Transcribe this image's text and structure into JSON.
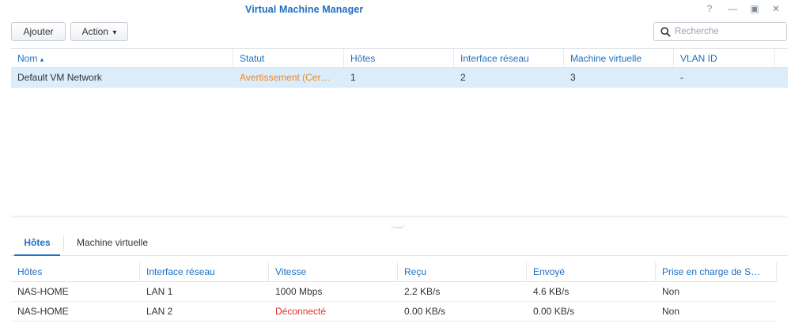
{
  "window": {
    "title": "Virtual Machine Manager",
    "controls": {
      "help": "?",
      "minimize": "—",
      "maximize": "▣",
      "close": "✕"
    }
  },
  "toolbar": {
    "add_label": "Ajouter",
    "action_label": "Action",
    "action_caret": "▾",
    "search_placeholder": "Recherche"
  },
  "top_table": {
    "columns": [
      "Nom",
      "Statut",
      "Hôtes",
      "Interface réseau",
      "Machine virtuelle",
      "VLAN ID"
    ],
    "sort_indicator": "▴",
    "rows": [
      {
        "name": "Default VM Network",
        "status": "Avertissement (Cer…",
        "hosts": "1",
        "interfaces": "2",
        "vms": "3",
        "vlan": "-"
      }
    ]
  },
  "tabs": [
    "Hôtes",
    "Machine virtuelle"
  ],
  "bottom_table": {
    "columns": [
      "Hôtes",
      "Interface réseau",
      "Vitesse",
      "Reçu",
      "Envoyé",
      "Prise en charge de S…"
    ],
    "rows": [
      {
        "host": "NAS-HOME",
        "interface": "LAN 1",
        "speed": "1000 Mbps",
        "received": "2.2 KB/s",
        "sent": "4.6 KB/s",
        "support": "Non"
      },
      {
        "host": "NAS-HOME",
        "interface": "LAN 2",
        "speed": "Déconnecté",
        "received": "0.00 KB/s",
        "sent": "0.00 KB/s",
        "support": "Non"
      }
    ]
  },
  "colors": {
    "accent": "#1f6fc2",
    "warning": "#f0871c",
    "error": "#e0352b",
    "selected_row": "#dbecfa"
  }
}
